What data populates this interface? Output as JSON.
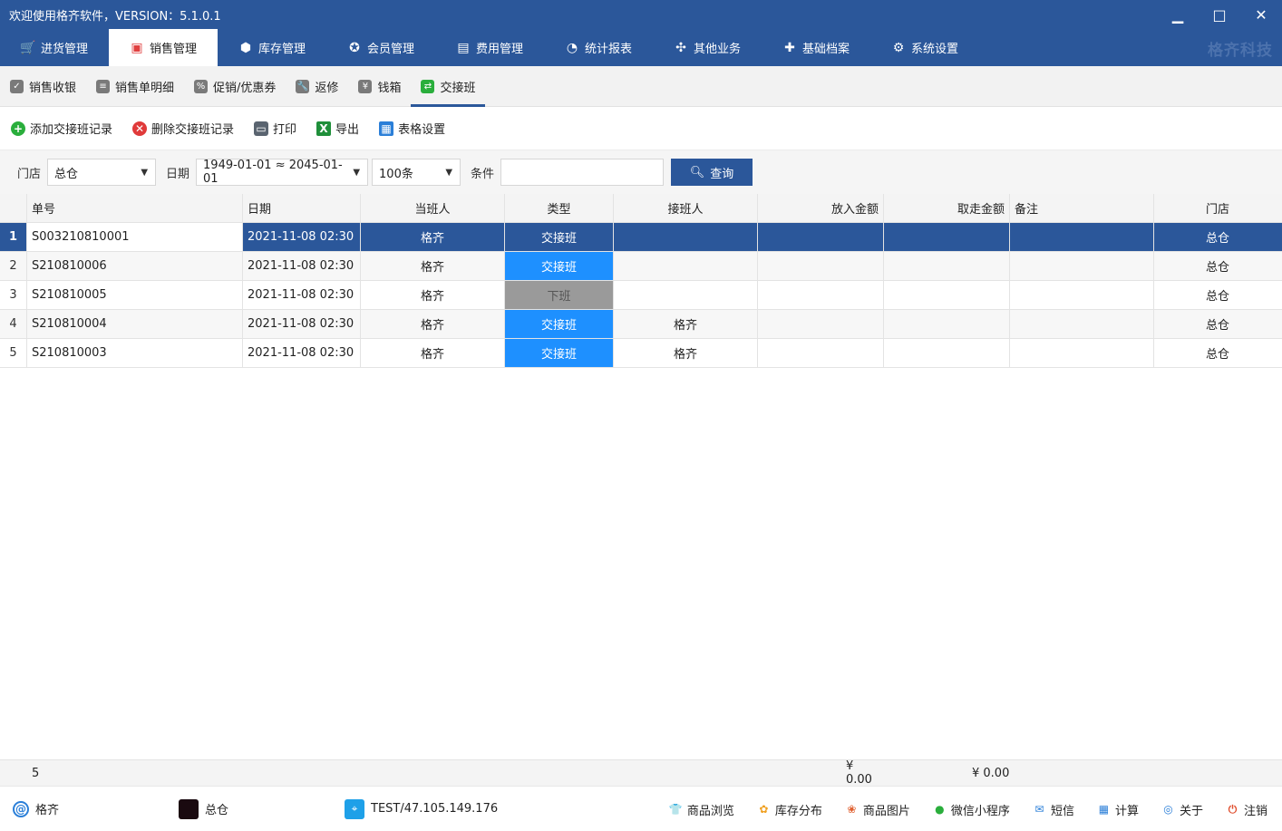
{
  "window": {
    "title": "欢迎使用格齐软件，VERSION：5.1.0.1",
    "minimize": "▁",
    "maximize": "□",
    "close": "✕"
  },
  "brand": "格齐科技",
  "main_nav": [
    {
      "label": "进货管理",
      "icon": "cart-icon",
      "glyph": "🛒"
    },
    {
      "label": "销售管理",
      "icon": "bag-icon",
      "glyph": "▣"
    },
    {
      "label": "库存管理",
      "icon": "box-icon",
      "glyph": "⬢"
    },
    {
      "label": "会员管理",
      "icon": "member-icon",
      "glyph": "✪"
    },
    {
      "label": "费用管理",
      "icon": "wallet-icon",
      "glyph": "▤"
    },
    {
      "label": "统计报表",
      "icon": "pie-chart-icon",
      "glyph": "◔"
    },
    {
      "label": "其他业务",
      "icon": "grid-icon",
      "glyph": "✣"
    },
    {
      "label": "基础档案",
      "icon": "puzzle-icon",
      "glyph": "✚"
    },
    {
      "label": "系统设置",
      "icon": "gear-icon",
      "glyph": "⚙"
    }
  ],
  "sub_nav": [
    {
      "label": "销售收银",
      "icon": "cashier-icon",
      "glyph": "✓"
    },
    {
      "label": "销售单明细",
      "icon": "list-icon",
      "glyph": "≡"
    },
    {
      "label": "促销/优惠券",
      "icon": "percent-icon",
      "glyph": "%"
    },
    {
      "label": "返修",
      "icon": "wrench-icon",
      "glyph": "🔧"
    },
    {
      "label": "钱箱",
      "icon": "money-icon",
      "glyph": "¥"
    },
    {
      "label": "交接班",
      "icon": "swap-icon",
      "glyph": "⇄"
    }
  ],
  "toolbar": {
    "add": "添加交接班记录",
    "delete": "删除交接班记录",
    "print": "打印",
    "export": "导出",
    "table_settings": "表格设置"
  },
  "filter": {
    "store_label": "门店",
    "store_value": "总仓",
    "date_label": "日期",
    "date_value": "1949-01-01 ≈ 2045-01-01",
    "page_size": "100条",
    "condition_label": "条件",
    "condition_value": "",
    "query": "查询"
  },
  "table": {
    "columns": [
      "单号",
      "日期",
      "当班人",
      "类型",
      "接班人",
      "放入金额",
      "取走金额",
      "备注",
      "门店"
    ],
    "rows": [
      {
        "n": "1",
        "code": "S003210810001",
        "date": "2021-11-08 02:30",
        "on_duty": "格齐",
        "type": "交接班",
        "successor": "",
        "in": "",
        "out": "",
        "note": "",
        "store": "总仓"
      },
      {
        "n": "2",
        "code": "S210810006",
        "date": "2021-11-08 02:30",
        "on_duty": "格齐",
        "type": "交接班",
        "successor": "",
        "in": "",
        "out": "",
        "note": "",
        "store": "总仓"
      },
      {
        "n": "3",
        "code": "S210810005",
        "date": "2021-11-08 02:30",
        "on_duty": "格齐",
        "type": "下班",
        "successor": "",
        "in": "",
        "out": "",
        "note": "",
        "store": "总仓"
      },
      {
        "n": "4",
        "code": "S210810004",
        "date": "2021-11-08 02:30",
        "on_duty": "格齐",
        "type": "交接班",
        "successor": "格齐",
        "in": "",
        "out": "",
        "note": "",
        "store": "总仓"
      },
      {
        "n": "5",
        "code": "S210810003",
        "date": "2021-11-08 02:30",
        "on_duty": "格齐",
        "type": "交接班",
        "successor": "格齐",
        "in": "",
        "out": "",
        "note": "",
        "store": "总仓"
      }
    ],
    "totals": {
      "count": "5",
      "in_total": "¥ 0.00",
      "out_total": "¥ 0.00"
    }
  },
  "status": {
    "user": "格齐",
    "store": "总仓",
    "server": "TEST/47.105.149.176",
    "links": [
      {
        "label": "商品浏览",
        "icon": "shirt-icon",
        "glyph": "👕",
        "color": "#e05050"
      },
      {
        "label": "库存分布",
        "icon": "distribution-icon",
        "glyph": "✿",
        "color": "#f0a020"
      },
      {
        "label": "商品图片",
        "icon": "image-icon",
        "glyph": "❀",
        "color": "#e06030"
      },
      {
        "label": "微信小程序",
        "icon": "wechat-icon",
        "glyph": "●",
        "color": "#2aae3c"
      },
      {
        "label": "短信",
        "icon": "mail-icon",
        "glyph": "✉",
        "color": "#2b7fd8"
      },
      {
        "label": "计算",
        "icon": "calculator-icon",
        "glyph": "▦",
        "color": "#2b7fd8"
      },
      {
        "label": "关于",
        "icon": "about-icon",
        "glyph": "◎",
        "color": "#2b7fd8"
      },
      {
        "label": "注销",
        "icon": "power-icon",
        "glyph": "⏻",
        "color": "#e05030"
      }
    ]
  },
  "colors": {
    "primary": "#2b579a",
    "type_blue": "#1e90ff",
    "type_gray": "#9a9a9a"
  }
}
